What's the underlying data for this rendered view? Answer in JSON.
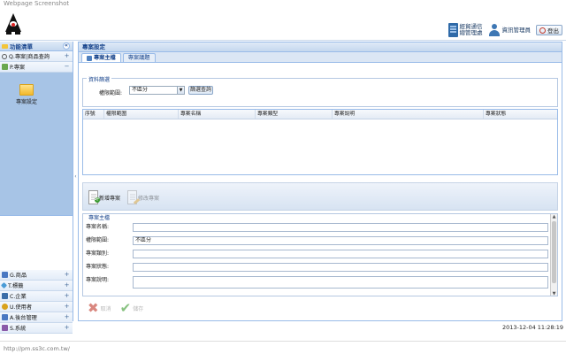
{
  "window": {
    "caption": "Webpage Screenshot"
  },
  "header": {
    "org_line1": "經貿通信",
    "org_line2": "總管理處",
    "user": "資訊管理員",
    "logout": "登出"
  },
  "sidebar": {
    "title": "功能清單",
    "collapse_symbol": "«",
    "top_items": [
      {
        "label": "Q.專案|商品查詢",
        "toggle": "+"
      },
      {
        "label": "P.專案",
        "toggle": "−"
      }
    ],
    "launcher_label": "專案設定",
    "bottom_items": [
      {
        "label": "G.商品",
        "toggle": "+"
      },
      {
        "label": "T.標籤",
        "toggle": "+"
      },
      {
        "label": "C.企業",
        "toggle": "+"
      },
      {
        "label": "U.使用者",
        "toggle": "+"
      },
      {
        "label": "A.後台管理",
        "toggle": "+"
      },
      {
        "label": "S.系統",
        "toggle": "+"
      }
    ],
    "colors": {
      "icons": [
        "#4a78c2",
        "#4a9bd6",
        "#3c6ea8",
        "#d9a21c",
        "#4a78c2",
        "#8a5aa8"
      ]
    }
  },
  "main": {
    "title": "專案設定",
    "tabs": [
      {
        "label": "專案主檔",
        "active": true
      },
      {
        "label": "專案議題",
        "active": false
      }
    ],
    "query": {
      "legend": "資料篩選",
      "label": "權限範圍:",
      "select_value": "不區分",
      "button": "篩選查詢"
    },
    "grid": {
      "columns": [
        "序號",
        "權限範圍",
        "專案名稱",
        "專案類型",
        "專案說明",
        "專案狀態"
      ]
    },
    "toolbar": {
      "add": "新增專案",
      "edit": "修改專案"
    },
    "detail": {
      "legend": "專案主檔",
      "fields": [
        {
          "label": "專案名稱:",
          "value": ""
        },
        {
          "label": "權限範圍:",
          "value": "不區分"
        },
        {
          "label": "專案類別:",
          "value": ""
        },
        {
          "label": "專案狀態:",
          "value": ""
        },
        {
          "label": "專案說明:",
          "value": ""
        }
      ],
      "cancel": "取消",
      "save": "儲存"
    }
  },
  "footer": {
    "datetime": "2013-12-04 11:28:19",
    "status_url": "http://pm.ss3c.com.tw/"
  }
}
